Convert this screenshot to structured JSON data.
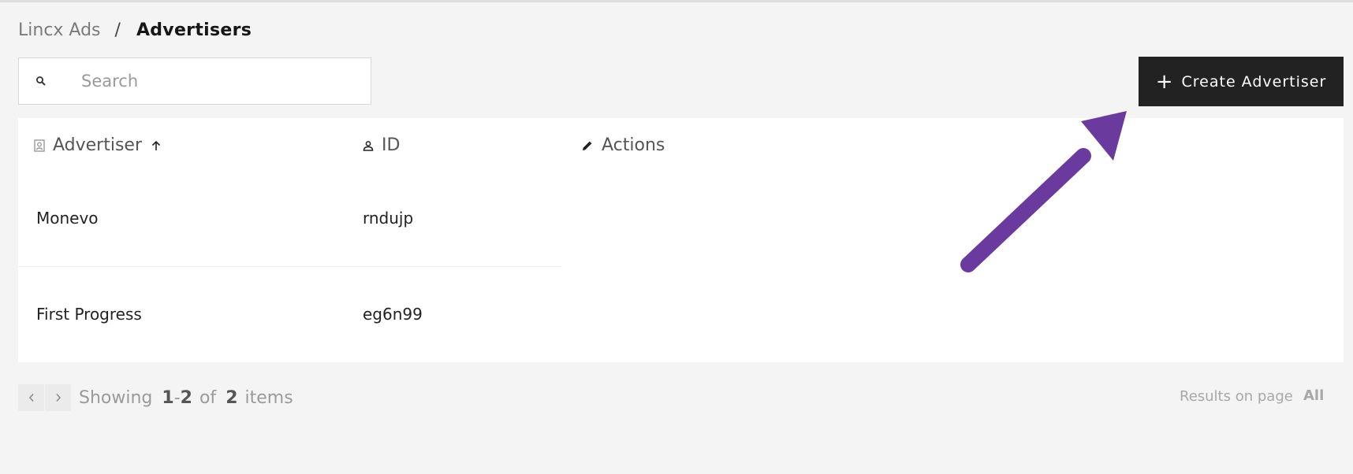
{
  "breadcrumb": {
    "parent": "Lincx Ads",
    "separator": "/",
    "current": "Advertisers"
  },
  "search": {
    "placeholder": "Search",
    "value": "",
    "icon": "search-icon"
  },
  "toolbar": {
    "create_label": "Create Advertiser",
    "create_icon": "plus-icon"
  },
  "table": {
    "columns": [
      {
        "label": "Advertiser",
        "icon": "advertiser-badge-icon",
        "sort": "ascending"
      },
      {
        "label": "ID",
        "icon": "person-icon"
      },
      {
        "label": "Actions",
        "icon": "pencil-icon"
      }
    ],
    "rows": [
      {
        "advertiser": "Monevo",
        "id": "rndujp"
      },
      {
        "advertiser": "First Progress",
        "id": "eg6n99"
      }
    ]
  },
  "pagination": {
    "showing_label": "Showing",
    "range_start": "1",
    "range_sep": "-",
    "range_end": "2",
    "of_label": "of",
    "total": "2",
    "items_label": "items",
    "results_label": "Results on page",
    "results_value": "All"
  },
  "annotation": {
    "arrow_color": "#6b3a9e"
  },
  "colors": {
    "button_bg": "#222222",
    "page_bg": "#f4f4f4"
  }
}
